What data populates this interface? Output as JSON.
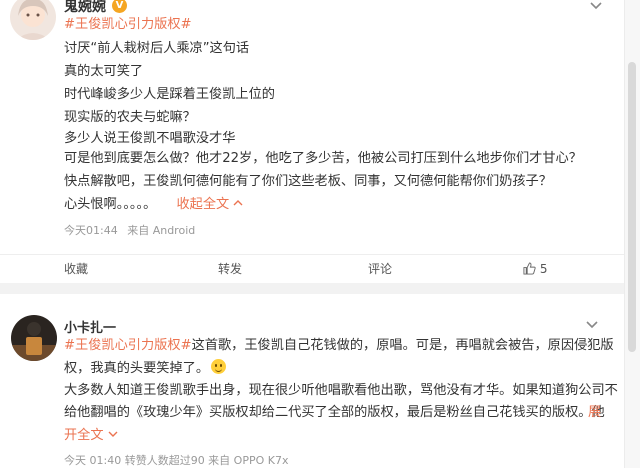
{
  "post1": {
    "username": "鬼婉婉",
    "verified_badge": "V",
    "hashtag": "#王俊凯心引力版权#",
    "lines": [
      "讨厌“前人栽树后人乘凉”这句话",
      "真的太可笑了",
      "时代峰峻多少人是踩着王俊凯上位的",
      "现实版的农夫与蛇嘛？",
      "多少人说王俊凯不唱歌没才华",
      "可是他到底要怎么做？他才22岁，他吃了多少苦，他被公司打压到什么地步你们才甘心？",
      "快点解散吧，王俊凯何德何能有了你们这些老板、同事，又何德何能帮你们奶孩子？"
    ],
    "last_line_text": "心头恨啊。。。。。",
    "collapse_label": "收起全文",
    "meta_time": "今天01:44",
    "meta_source": "来自 Android",
    "actions": {
      "favorite": "收藏",
      "repost": "转发",
      "comment": "评论",
      "like_count": "5"
    }
  },
  "post2": {
    "username": "小卡扎一",
    "line1_hashtag": "#王俊凯心引力版权#",
    "line1_rest": "这首歌，王俊凯自己花钱做的，原唱。可是，再唱就会被告，原因侵犯版",
    "line2": "权，我真的头要笑掉了。",
    "line3": "大多数人知道王俊凯歌手出身，现在很少听他唱歌看他出歌，骂他没有才华。如果知道狗公司不",
    "line4": "给他翻唱的《玫瑰少年》买版权却给二代买了全部的版权，最后是粉丝自己花钱买的版权。他",
    "expand_label_1": "展",
    "expand_label_2": "开全文",
    "meta": "今天 01:40 转赞人数超过90 来自 OPPO K7x"
  },
  "colors": {
    "accent": "#eb7350",
    "text": "#333333",
    "meta": "#999999",
    "page_bg": "#f2f2f2",
    "card_bg": "#ffffff"
  },
  "icons": [
    "chevron-down-icon",
    "verified-icon",
    "chevron-up-icon",
    "like-icon",
    "smile-emoji-icon"
  ]
}
